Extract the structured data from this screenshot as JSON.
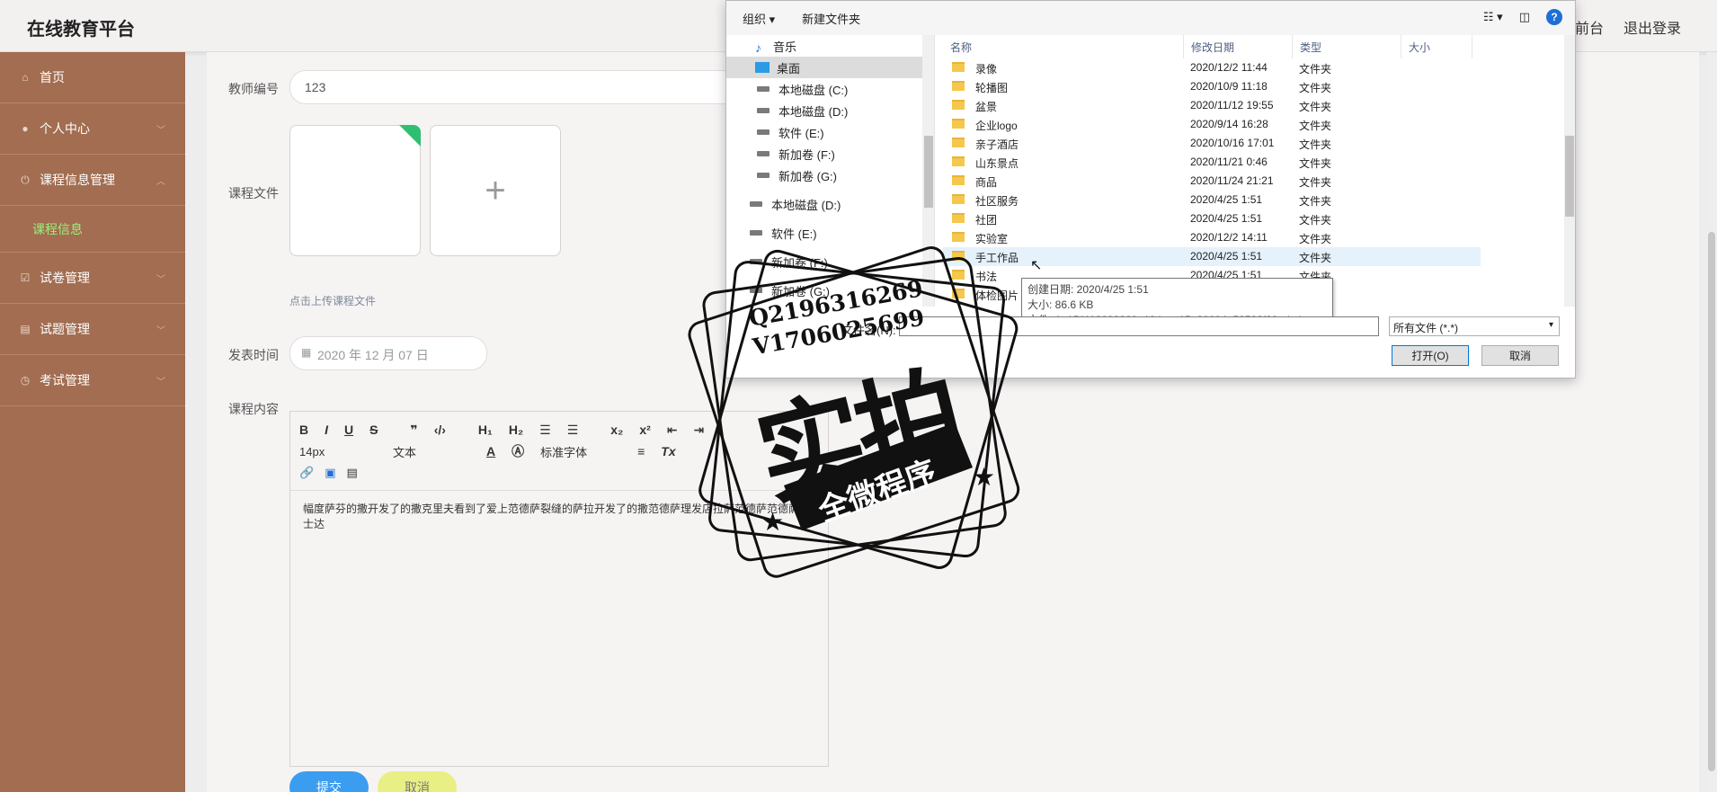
{
  "app": {
    "title": "在线教育平台",
    "links": [
      "前台",
      "退出登录"
    ]
  },
  "sidebar": {
    "items": [
      {
        "label": "首页",
        "icon": "home-icon"
      },
      {
        "label": "个人中心",
        "icon": "user-icon"
      },
      {
        "label": "课程信息管理",
        "icon": "power-icon"
      },
      {
        "label": "课程信息",
        "icon": ""
      },
      {
        "label": "试卷管理",
        "icon": "check-icon"
      },
      {
        "label": "试题管理",
        "icon": "chat-icon"
      },
      {
        "label": "考试管理",
        "icon": "clock-icon"
      }
    ]
  },
  "form": {
    "teacher_label": "教师编号",
    "teacher_value": "123",
    "file_label": "课程文件",
    "upload_hint": "点击上传课程文件",
    "date_label": "发表时间",
    "date_value": "2020 年 12 月 07 日",
    "content_label": "课程内容",
    "editor_font_size": "14px",
    "editor_format": "文本",
    "editor_font": "标准字体",
    "editor_text": "幅度萨芬的撒开发了的撒克里夫看到了爱上范德萨裂缝的萨拉开发了的撒范德萨理发店拉萨范德萨范德萨富士达",
    "submit": "提交",
    "cancel": "取消"
  },
  "dialog": {
    "toolbar": {
      "organize": "组织 ▾",
      "new_folder": "新建文件夹"
    },
    "nav": [
      "音乐",
      "桌面",
      "本地磁盘 (C:)",
      "本地磁盘 (D:)",
      "软件 (E:)",
      "新加卷 (F:)",
      "新加卷 (G:)",
      "本地磁盘 (D:)",
      "软件 (E:)",
      "新加卷 (F:)",
      "新加卷 (G:)"
    ],
    "columns": [
      "名称",
      "修改日期",
      "类型",
      "大小"
    ],
    "files": [
      {
        "name": "录像",
        "date": "2020/12/2 11:44",
        "type": "文件夹"
      },
      {
        "name": "轮播图",
        "date": "2020/10/9 11:18",
        "type": "文件夹"
      },
      {
        "name": "盆景",
        "date": "2020/11/12 19:55",
        "type": "文件夹"
      },
      {
        "name": "企业logo",
        "date": "2020/9/14 16:28",
        "type": "文件夹"
      },
      {
        "name": "亲子酒店",
        "date": "2020/10/16 17:01",
        "type": "文件夹"
      },
      {
        "name": "山东景点",
        "date": "2020/11/21 0:46",
        "type": "文件夹"
      },
      {
        "name": "商品",
        "date": "2020/11/24 21:21",
        "type": "文件夹"
      },
      {
        "name": "社区服务",
        "date": "2020/4/25 1:51",
        "type": "文件夹"
      },
      {
        "name": "社团",
        "date": "2020/4/25 1:51",
        "type": "文件夹"
      },
      {
        "name": "实验室",
        "date": "2020/12/2 14:11",
        "type": "文件夹"
      },
      {
        "name": "手工作品",
        "date": "2020/4/25 1:51",
        "type": "文件夹"
      },
      {
        "name": "书法",
        "date": "2020/4/25 1:51",
        "type": "文件夹"
      },
      {
        "name": "体检图片",
        "date": "",
        "type": ""
      }
    ],
    "tooltip": {
      "created": "创建日期: 2020/4/25 1:51",
      "size": "大小: 86.6 KB",
      "files": "文件: 1_151118093839_10.jpg, 15a20004e58538f39ede.jpg"
    },
    "filename_label": "文件名(N):",
    "filter": "所有文件 (*.*)",
    "open": "打开(O)",
    "cancel": "取消"
  },
  "watermark": {
    "qq": "Q2196316269",
    "v": "V1706025699",
    "main": "实拍",
    "banner": "全微程序"
  },
  "colors": {
    "sidebar": "#a26d50",
    "active_menu": "#9bf07f",
    "submit": "#3b9df0",
    "cancel": "#e8ef84"
  }
}
